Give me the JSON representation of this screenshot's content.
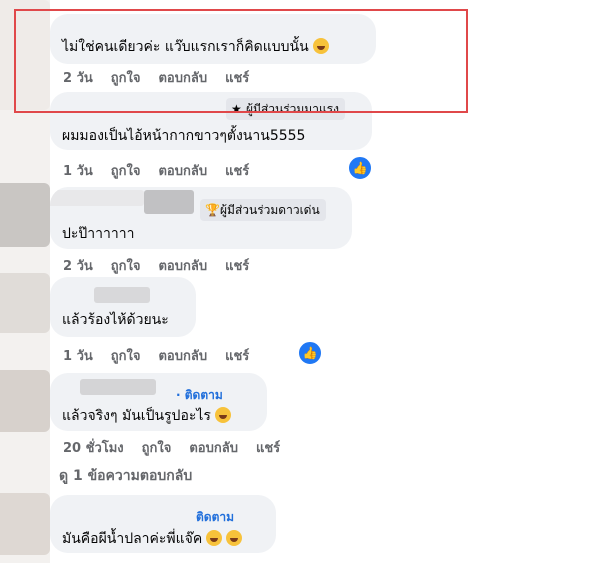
{
  "comments": [
    {
      "text": "ไม่ใช่คนเดียวค่ะ แว๊บแรกเราก็คิดแบบนั้น",
      "emoji": "laughing-emoji",
      "time": "2 วัน",
      "like": "ถูกใจ",
      "reply": "ตอบกลับ",
      "share": "แชร์"
    },
    {
      "badge": "ผู้มีส่วนร่วมมาแรง",
      "badge_icon": "star-icon",
      "text": "ผมมองเป็นไอ้หน้ากากขาวๆตั้งนาน5555",
      "time": "1 วัน",
      "like": "ถูกใจ",
      "reply": "ตอบกลับ",
      "share": "แชร์",
      "reaction": "like"
    },
    {
      "badge": "ผู้มีส่วนร่วมดาวเด่น",
      "badge_icon": "trophy-icon",
      "text": "ปะป๊าาาาาา",
      "time": "2 วัน",
      "like": "ถูกใจ",
      "reply": "ตอบกลับ",
      "share": "แชร์"
    },
    {
      "text": "แล้วร้องไห้ด้วยนะ",
      "time": "1 วัน",
      "like": "ถูกใจ",
      "reply": "ตอบกลับ",
      "share": "แชร์",
      "reaction": "like"
    },
    {
      "follow": "· ติดตาม",
      "text": "แล้วจริงๆ มันเป็นรูปอะไร",
      "emoji": "laughing-emoji",
      "time": "20 ชั่วโมง",
      "like": "ถูกใจ",
      "reply": "ตอบกลับ",
      "share": "แชร์",
      "more_replies": "ดู 1 ข้อความตอบกลับ"
    },
    {
      "follow": "ติดตาม",
      "text": "มันคือผีน้ำปลาค่ะพี่แจ๊ค",
      "emoji": "laughing-emoji x2"
    }
  ],
  "colors": {
    "bubble": "#f0f2f5",
    "link": "#216fdb",
    "meta": "#65676b",
    "highlight": "#e0484a",
    "like": "#2078f4"
  }
}
